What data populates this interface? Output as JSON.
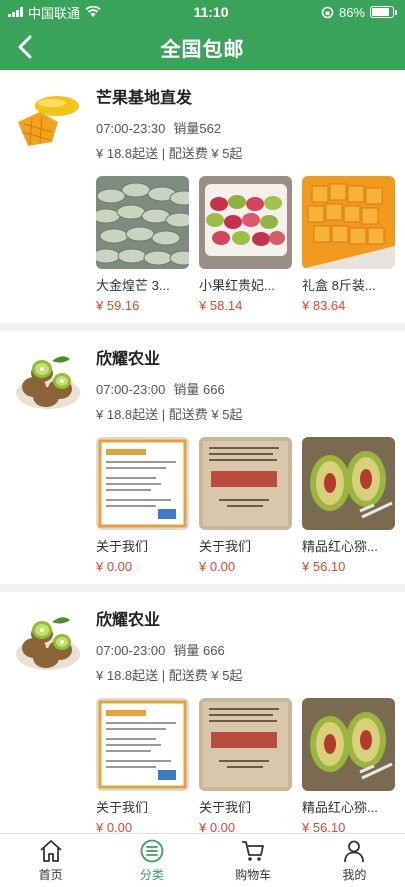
{
  "status_bar": {
    "carrier": "中国联通",
    "time": "11:10",
    "battery": "86%"
  },
  "header": {
    "title": "全国包邮"
  },
  "stores": [
    {
      "name": "芒果基地直发",
      "hours": "07:00-23:30",
      "sales": "销量562",
      "fees": "¥ 18.8起送 | 配送费 ¥ 5起",
      "products": [
        {
          "name": "大金煌芒 3...",
          "price": "¥ 59.16"
        },
        {
          "name": "小果红贵妃...",
          "price": "¥ 58.14"
        },
        {
          "name": "礼盒 8斤装...",
          "price": "¥ 83.64"
        }
      ]
    },
    {
      "name": "欣耀农业",
      "hours": "07:00-23:00",
      "sales": "销量 666",
      "fees": "¥ 18.8起送 | 配送费 ¥ 5起",
      "products": [
        {
          "name": "关于我们",
          "price": "¥ 0.00"
        },
        {
          "name": "关于我们",
          "price": "¥ 0.00"
        },
        {
          "name": "精品红心猕...",
          "price": "¥ 56.10"
        }
      ]
    },
    {
      "name": "欣耀农业",
      "hours": "07:00-23:00",
      "sales": "销量 666",
      "fees": "¥ 18.8起送 | 配送费 ¥ 5起",
      "products": [
        {
          "name": "关于我们",
          "price": "¥ 0.00"
        },
        {
          "name": "关于我们",
          "price": "¥ 0.00"
        },
        {
          "name": "精品红心猕...",
          "price": "¥ 56.10"
        }
      ]
    }
  ],
  "tabbar": {
    "items": [
      {
        "label": "首页",
        "icon": "home-icon"
      },
      {
        "label": "分类",
        "icon": "category-icon",
        "active": true
      },
      {
        "label": "购物车",
        "icon": "cart-icon"
      },
      {
        "label": "我的",
        "icon": "user-icon"
      }
    ]
  },
  "colors": {
    "primary": "#3aa35a",
    "price": "#e2482c"
  }
}
